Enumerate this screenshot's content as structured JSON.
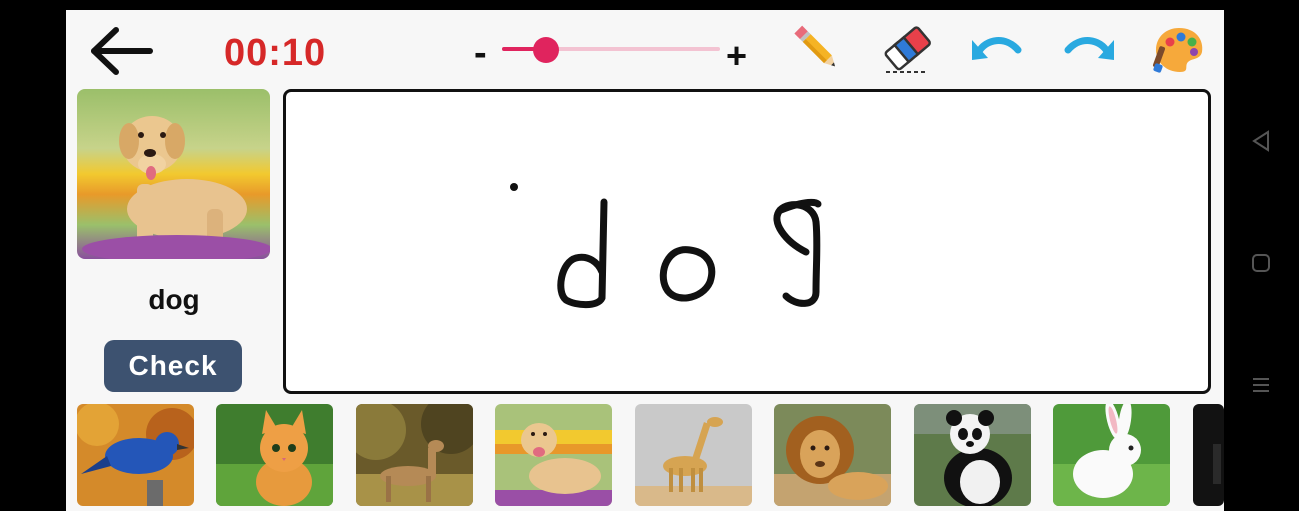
{
  "header": {
    "timer": "00:10",
    "brush_size": {
      "minus_label": "-",
      "plus_label": "+",
      "level": 0.2
    }
  },
  "tools": [
    {
      "name": "pencil-icon"
    },
    {
      "name": "eraser-icon"
    },
    {
      "name": "undo-icon"
    },
    {
      "name": "redo-icon"
    },
    {
      "name": "palette-icon"
    }
  ],
  "reference": {
    "word": "dog",
    "image": "golden-retriever-dog"
  },
  "check_button": {
    "label": "Check"
  },
  "canvas": {
    "drawn_text": "dog"
  },
  "thumbnails": [
    {
      "name": "bluebird"
    },
    {
      "name": "kitten"
    },
    {
      "name": "deer"
    },
    {
      "name": "dog"
    },
    {
      "name": "giraffe"
    },
    {
      "name": "lion"
    },
    {
      "name": "panda"
    },
    {
      "name": "rabbit"
    },
    {
      "name": "partial"
    }
  ],
  "colors": {
    "timer": "#d62828",
    "slider": "#e0245e",
    "check_button": "#3d5270",
    "undo_redo": "#29a9e0"
  }
}
